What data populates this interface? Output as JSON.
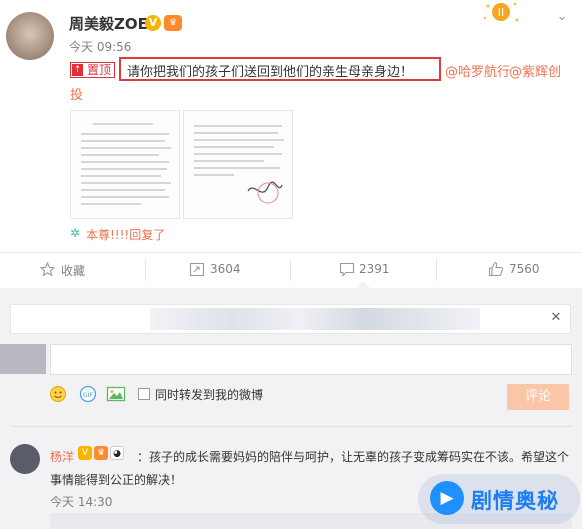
{
  "post": {
    "username": "周美毅ZOE",
    "verified_badge": "V",
    "member_badge": "♛",
    "zodiac_icon": "gemini-icon",
    "time": "今天 09:56",
    "pinned_label": "置顶",
    "text": "请你把我们的孩子们送回到他们的亲生母亲身边！",
    "mention_1": "@哈罗航行",
    "mention_2a": "@紫辉创",
    "mention_2b": "投",
    "reply_note": "本尊!!!!回复了"
  },
  "actions": {
    "favorite": "收藏",
    "repost": "3604",
    "comment": "2391",
    "like": "7560"
  },
  "comment_composer": {
    "sync_label": "同时转发到我的微博",
    "submit_label": "评论",
    "tools": [
      "emoji-icon",
      "gif-icon",
      "image-icon"
    ]
  },
  "comments": [
    {
      "name": "杨洋",
      "text_line1": "：孩子的成长需要妈妈的陪伴与呵护，让无辜的孩子变成筹码实在不该。希望这个",
      "text_line2": "事情能得到公正的解决！",
      "time": "今天 14:30"
    }
  ],
  "watermark": {
    "text": "剧情奥秘",
    "icon": "play-icon"
  },
  "colors": {
    "accent": "#eb7350",
    "highlight_box": "#e13a3a",
    "submit_disabled": "#f9c7a7",
    "panel_bg": "#f2f2f5",
    "watermark_blue": "#1c7ef0"
  }
}
